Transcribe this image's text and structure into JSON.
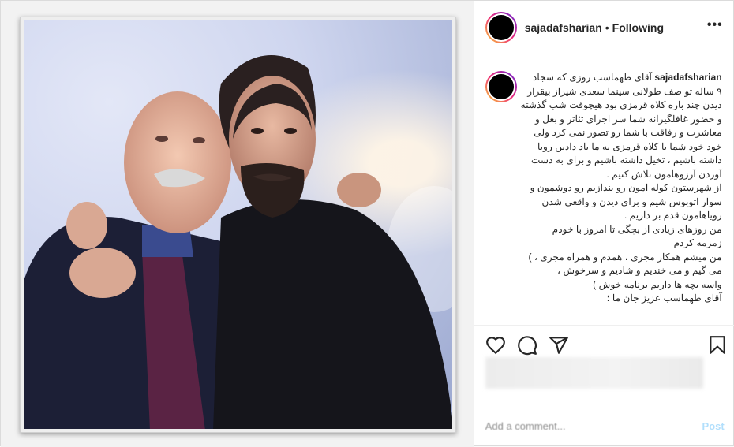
{
  "post": {
    "username": "sajadafsharian",
    "separator": "•",
    "follow_status": "Following",
    "more_label": "•••",
    "caption_lines": [
      "آقای طهماسب روزی که سجاد",
      "۹ ساله تو صف طولانی سینما سعدی شیراز بیقرار",
      "دیدن چند باره کلاه قرمزی بود هیچوقت شب گذشته",
      "و حضور غافلگیرانه شما سر اجرای تئاتر و بغل و",
      "معاشرت و رفاقت با شما رو تصور نمی کرد ولی",
      "خود خود شما با کلاه قرمزی به ما یاد دادین رویا",
      "داشته باشیم ، تخیل داشته باشیم و برای به دست",
      "آوردن آرزوهامون تلاش کنیم .",
      "از شهرستون کوله امون رو بندازیم رو دوشمون و",
      "سوار اتوبوس شیم و برای دیدن و واقعی شدن",
      "رویاهامون قدم بر داریم .",
      "من روزهای زیادی از بچگی تا امروز با خودم",
      "زمزمه کردم",
      "من میشم همکار مجری ، همدم و همراه مجری ، )",
      "می گیم و می خندیم و شادیم و سرخوش ،",
      "واسه بچه ها داریم برنامه خوش )",
      "آقای طهماسب عزیز جان ما ؛"
    ],
    "add_comment_placeholder": "Add a comment...",
    "post_button": "Post"
  },
  "icons": {
    "like": "heart-icon",
    "comment": "comment-icon",
    "share": "share-icon",
    "save": "bookmark-icon",
    "more": "more-icon"
  },
  "colors": {
    "link_disabled": "#b2dffc",
    "text": "#262626",
    "muted": "#8e8e8e",
    "story_ring": "#ee2a7b"
  }
}
